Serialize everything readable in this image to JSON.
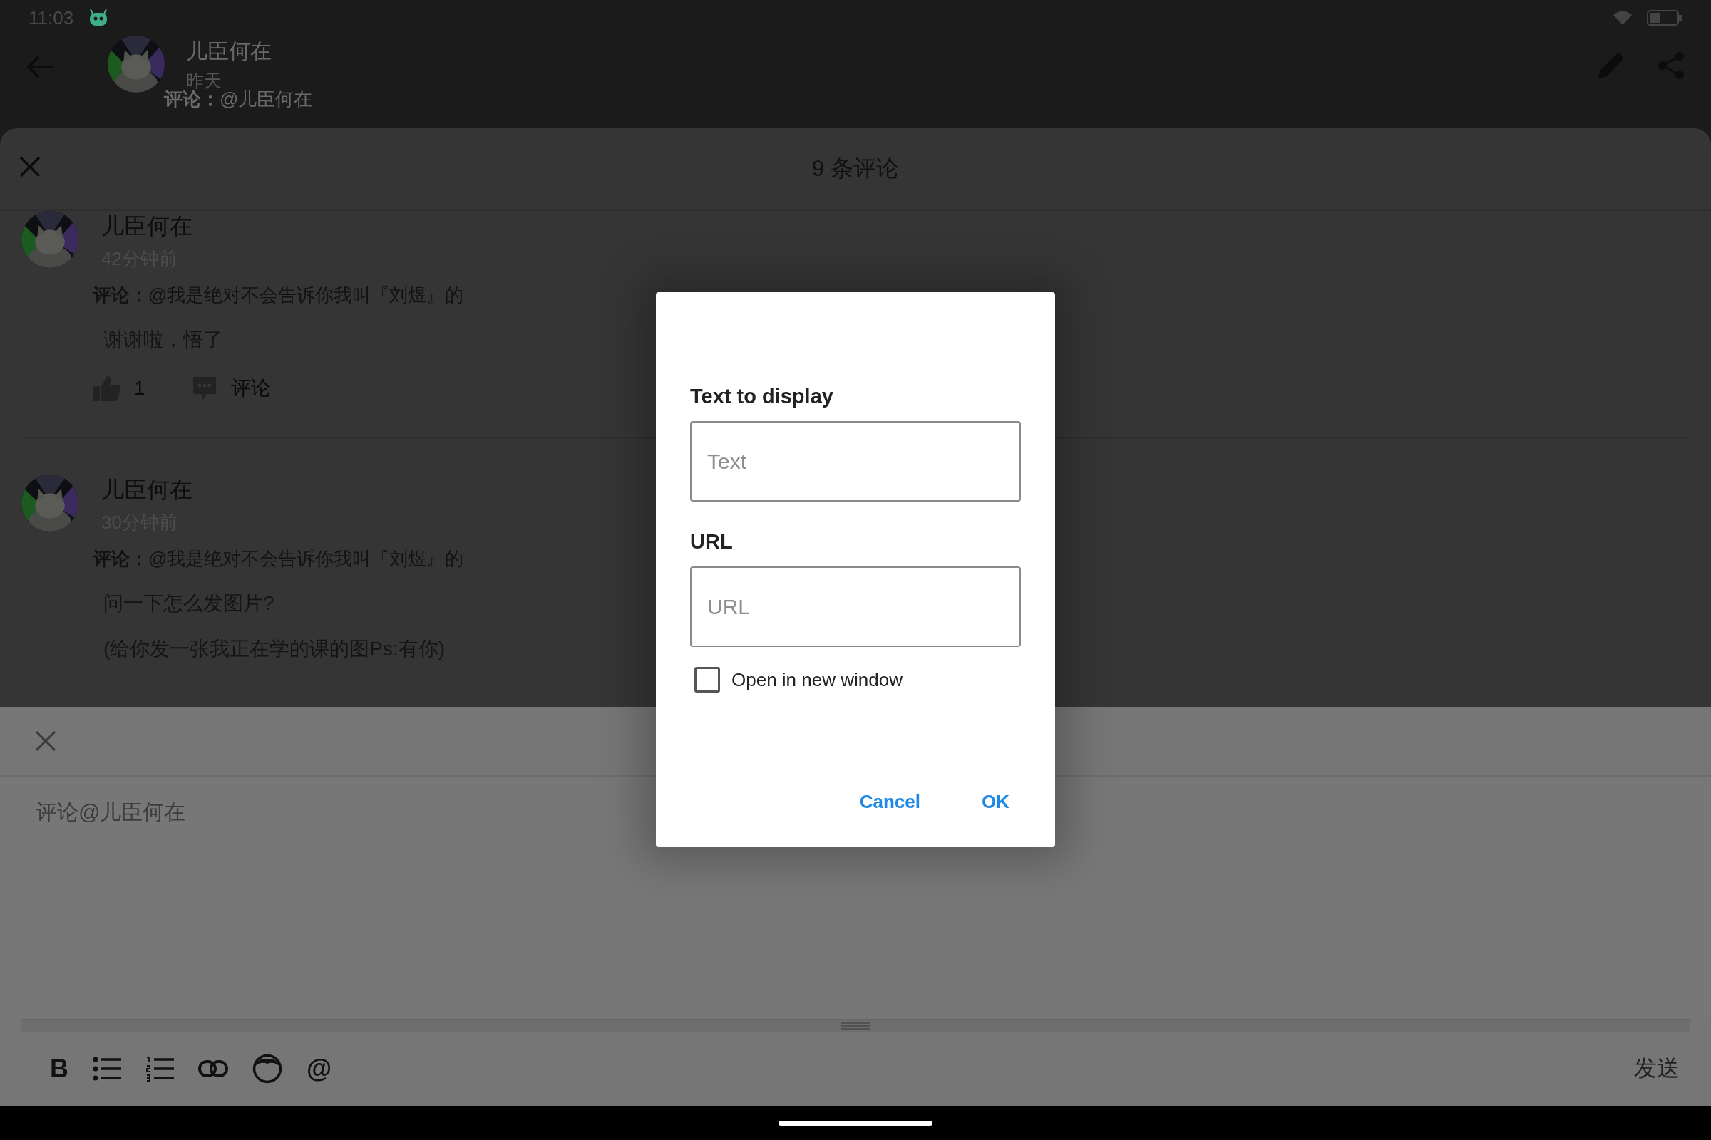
{
  "status_bar": {
    "time": "11:03"
  },
  "header": {
    "name": "儿臣何在",
    "date": "昨天",
    "comment_line": "**评论：**@儿臣何在"
  },
  "sheet": {
    "title": "9 条评论",
    "comments": [
      {
        "author": "儿臣何在",
        "time": "42分钟前",
        "reply_to": "**评论：**@我是绝对不会告诉你我叫『刘煜』的",
        "body": [
          "谢谢啦，悟了"
        ],
        "likes": "1",
        "comment_label": "评论"
      },
      {
        "author": "儿臣何在",
        "time": "30分钟前",
        "reply_to": "**评论：**@我是绝对不会告诉你我叫『刘煜』的",
        "body": [
          "问一下怎么发图片?",
          "(给你发一张我正在学的课的图Ps:有你)"
        ]
      }
    ]
  },
  "editor": {
    "placeholder": "评论@儿臣何在",
    "send": "发送",
    "toolbar": [
      {
        "kind": "text",
        "label": "B"
      },
      {
        "kind": "bullet-list"
      },
      {
        "kind": "numbered-list"
      },
      {
        "kind": "link"
      },
      {
        "kind": "emoji"
      },
      {
        "kind": "text",
        "label": "@"
      }
    ]
  },
  "dialog": {
    "fields": [
      {
        "label": "Text to display",
        "placeholder": "Text"
      },
      {
        "label": "URL",
        "placeholder": "URL"
      }
    ],
    "checkbox": {
      "label": "Open in new window",
      "checked": false
    },
    "buttons": [
      "Cancel",
      "OK"
    ]
  }
}
